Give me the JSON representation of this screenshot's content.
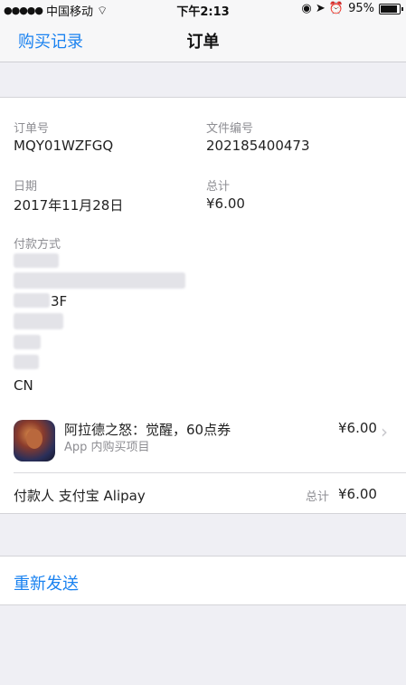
{
  "status_bar": {
    "signal": "●●●●●",
    "carrier": "中国移动",
    "wifi": "⌔",
    "time": "下午2:13",
    "icons": "◉ ➤ ⏰",
    "battery": "95%"
  },
  "nav": {
    "back_label": "购买记录",
    "title": "订单"
  },
  "order": {
    "order_no_label": "订单号",
    "order_no": "MQY01WZFGQ",
    "doc_no_label": "文件编号",
    "doc_no": "202185400473",
    "date_label": "日期",
    "date": "2017年11月28日",
    "total_label": "总计",
    "total": "¥6.00",
    "payment_label": "付款方式",
    "address_fragment": "3F",
    "country": "CN"
  },
  "item": {
    "icon_name": "game-app-icon",
    "name": "阿拉德之怒：觉醒，60点券",
    "subtitle": "App 内购买项目",
    "price": "¥6.00",
    "chevron": "›"
  },
  "payer": {
    "text": "付款人 支付宝 Alipay",
    "total_label": "总计",
    "total": "¥6.00"
  },
  "resend": {
    "label": "重新发送"
  }
}
